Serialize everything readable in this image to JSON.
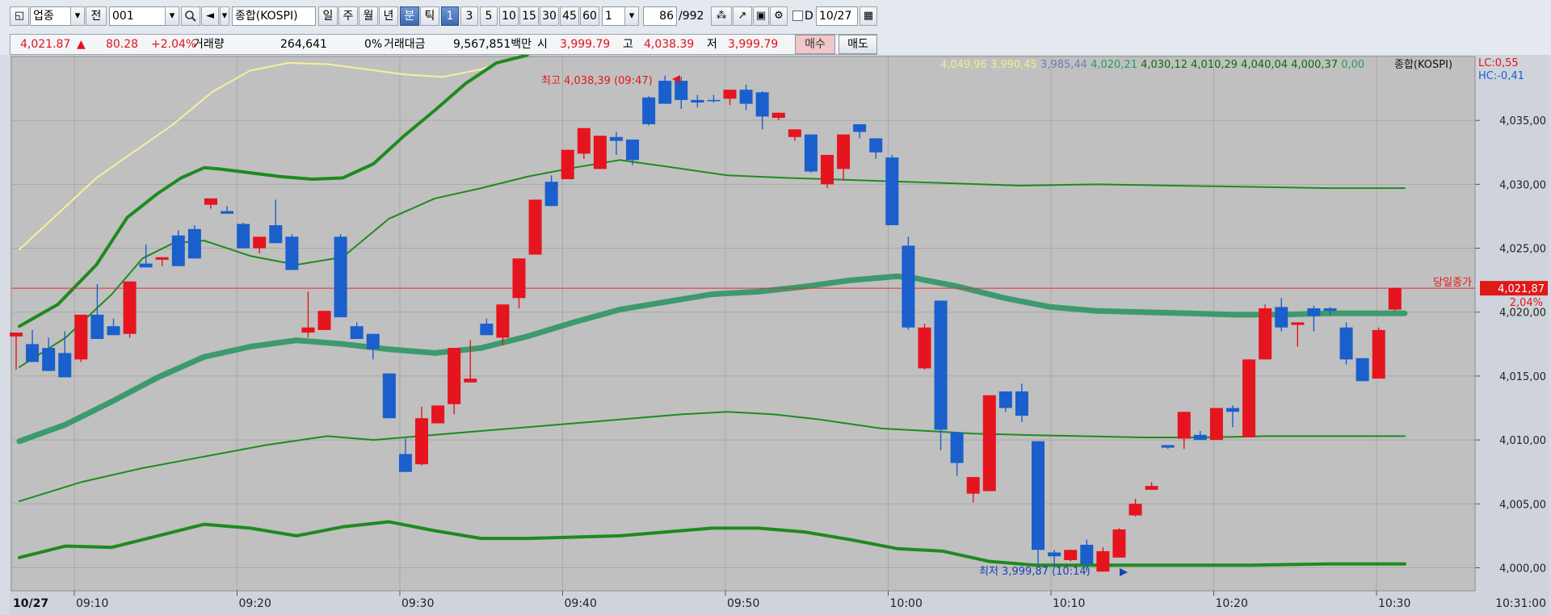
{
  "toolbar": {
    "market_type": "업종",
    "prev_label": "전",
    "code": "001",
    "index_name": "종합(KOSPI)",
    "period_buttons": [
      "일",
      "주",
      "월",
      "년",
      "분",
      "틱"
    ],
    "minute_buttons": [
      "1",
      "3",
      "5",
      "10",
      "15",
      "30",
      "45",
      "60"
    ],
    "interval_value": "1",
    "count_current": "86",
    "count_total": "/992",
    "d_label": "D",
    "date": "10/27"
  },
  "quote": {
    "price": "4,021.87",
    "arrow": "▲",
    "change": "80.28",
    "change_pct": "+2.04%",
    "volume_label": "거래량",
    "volume": "264,641",
    "volume_pct": "0%",
    "amount_label": "거래대금",
    "amount": "9,567,851백만",
    "open_label": "시",
    "open": "3,999.79",
    "high_label": "고",
    "high": "4,038.39",
    "low_label": "저",
    "low": "3,999.79",
    "buy_label": "매수",
    "sell_label": "매도"
  },
  "colors": {
    "up": "#e5141e",
    "down": "#1a5fcc",
    "plot_bg": "#c0c0c0",
    "band_outer": "#1f8a1f",
    "band_mid": "#3c9a6e",
    "band_upper_yellow": "#f5f09a",
    "ref_line": "#e03030"
  },
  "chart_data": {
    "type": "candlestick",
    "x_ticks": [
      "09:10",
      "09:20",
      "09:30",
      "09:40",
      "09:50",
      "10:00",
      "10:10",
      "10:20",
      "10:30"
    ],
    "x_date_label": "10/27",
    "x_end_label": "10:31:00",
    "y_ticks": [
      "4,035,00",
      "4,030,00",
      "4,025,00",
      "4,020,00",
      "4,015,00",
      "4,010,00",
      "4,005,00",
      "4,000,00"
    ],
    "y_range": [
      3998.2,
      4040.0
    ],
    "legend_values": [
      {
        "text": "4,049,96",
        "color": "#f0ec90"
      },
      {
        "text": "3,990,45",
        "color": "#f0ec90"
      },
      {
        "text": "3,985,44",
        "color": "#6a7eb4"
      },
      {
        "text": "4,020,21",
        "color": "#2c9a5a"
      },
      {
        "text": "4,030,12",
        "color": "#0a6e0a"
      },
      {
        "text": "4,010,29",
        "color": "#0a6e0a"
      },
      {
        "text": "4,040,04",
        "color": "#0a6e0a"
      },
      {
        "text": "4,000,37",
        "color": "#0a6e0a"
      },
      {
        "text": "0,00",
        "color": "#2c9a5a"
      }
    ],
    "legend_title": "종합(KOSPI)",
    "lc": "LC:0,55",
    "hc": "HC:-0,41",
    "high_annotation": "최고 4,038,39 (09:47)",
    "low_annotation": "최저 3,999,87 (10:14)",
    "close_label": "당일종가",
    "close_value": "4,021,87",
    "close_pct": "2,04%",
    "ref_value": 4021.87,
    "candles": [
      [
        4018.1,
        4015.7,
        4018.4,
        4015.5
      ],
      [
        4017.5,
        4018.2,
        4016.1,
        4018.6
      ],
      [
        4017.2,
        4018.0,
        4015.4,
        4016.5
      ],
      [
        4016.8,
        4016.3,
        4014.9,
        4018.5
      ],
      [
        4016.3,
        4016.9,
        4019.8,
        4016.1
      ],
      [
        4019.8,
        4020.4,
        4017.9,
        4022.2
      ],
      [
        4018.9,
        4018.4,
        4018.2,
        4019.5
      ],
      [
        4018.3,
        4018.0,
        4022.4,
        4018.0
      ],
      [
        4023.8,
        4024.9,
        4023.5,
        4025.3
      ],
      [
        4024.1,
        4024.3,
        4024.3,
        4023.6
      ],
      [
        4026.0,
        4026.4,
        4023.6,
        4026.2
      ],
      [
        4026.5,
        4026.2,
        4024.2,
        4026.8
      ],
      [
        4028.4,
        4028.8,
        4028.9,
        4028.1
      ],
      [
        4027.9,
        4028.3,
        4027.7,
        4028.0
      ],
      [
        4026.9,
        4027.0,
        4025.0,
        4026.2
      ],
      [
        4025.0,
        4025.4,
        4025.9,
        4024.6
      ],
      [
        4026.8,
        4028.8,
        4025.4,
        4026.0
      ],
      [
        4025.9,
        4026.1,
        4023.3,
        4026.1
      ],
      [
        4018.4,
        4021.6,
        4018.8,
        4018.0
      ],
      [
        4018.6,
        4019.0,
        4020.1,
        4018.7
      ],
      [
        4025.9,
        4026.1,
        4019.6,
        4025.6
      ],
      [
        4018.9,
        4019.2,
        4017.9,
        4018.9
      ],
      [
        4018.3,
        4016.4,
        4017.1,
        4016.3
      ],
      [
        4015.2,
        4014.2,
        4011.7,
        4013.8
      ],
      [
        4008.9,
        4010.1,
        4007.5,
        4009.5
      ],
      [
        4008.1,
        4008.0,
        4011.7,
        4012.6
      ],
      [
        4011.3,
        4011.4,
        4012.7,
        4012.5
      ],
      [
        4012.8,
        4012.9,
        4017.2,
        4012.0
      ],
      [
        4014.5,
        4017.8,
        4014.8,
        4016.8
      ],
      [
        4019.1,
        4019.1,
        4018.2,
        4019.5
      ],
      [
        4018.0,
        4017.4,
        4020.6,
        4018.5
      ],
      [
        4021.1,
        4020.7,
        4024.2,
        4020.3
      ],
      [
        4024.5,
        4024.6,
        4028.8,
        4024.7
      ],
      [
        4030.2,
        4030.7,
        4028.3,
        4029.7
      ],
      [
        4030.4,
        4031.1,
        4032.7,
        4031.4
      ],
      [
        4032.4,
        4032.0,
        4034.4,
        4032.0
      ],
      [
        4031.2,
        4031.5,
        4033.8,
        4032.1
      ],
      [
        4033.7,
        4034.1,
        4033.4,
        4032.3
      ],
      [
        4033.5,
        4033.2,
        4031.9,
        4031.5
      ],
      [
        4036.8,
        4036.9,
        4034.7,
        4034.6
      ],
      [
        4038.1,
        4038.5,
        4036.3,
        4036.5
      ],
      [
        4038.1,
        4038.4,
        4036.6,
        4035.9
      ],
      [
        4036.6,
        4037.0,
        4036.4,
        4036.0
      ],
      [
        4036.6,
        4036.4,
        4036.5,
        4037.0
      ],
      [
        4036.7,
        4036.4,
        4037.4,
        4036.2
      ],
      [
        4037.4,
        4037.8,
        4036.3,
        4035.8
      ],
      [
        4037.2,
        4037.3,
        4035.3,
        4034.3
      ],
      [
        4035.2,
        4035.2,
        4035.6,
        4035.0
      ],
      [
        4033.7,
        4033.6,
        4034.3,
        4033.4
      ],
      [
        4033.9,
        4033.1,
        4031.0,
        4030.9
      ],
      [
        4030.0,
        4029.7,
        4032.3,
        4030.2
      ],
      [
        4031.2,
        4030.3,
        4033.9,
        4032.4
      ],
      [
        4034.7,
        4034.0,
        4034.1,
        4033.6
      ],
      [
        4033.6,
        4033.6,
        4032.5,
        4032.0
      ],
      [
        4032.1,
        4032.3,
        4026.8,
        4027.1
      ],
      [
        4025.2,
        4025.9,
        4018.8,
        4018.6
      ],
      [
        4015.6,
        4015.5,
        4018.8,
        4019.1
      ],
      [
        4020.9,
        4020.8,
        4010.8,
        4009.2
      ],
      [
        4010.6,
        4009.7,
        4008.2,
        4007.2
      ],
      [
        4005.8,
        4005.2,
        4007.1,
        4005.1
      ],
      [
        4006.0,
        4006.6,
        4013.5,
        4012.8
      ],
      [
        4013.8,
        4013.2,
        4012.5,
        4012.2
      ],
      [
        4013.8,
        4014.4,
        4011.9,
        4011.4
      ],
      [
        4009.9,
        4009.7,
        4001.4,
        4000.2
      ],
      [
        4001.2,
        4001.4,
        4000.9,
        4000.1
      ],
      [
        4000.6,
        4000.5,
        4001.4,
        4001.2
      ],
      [
        4001.8,
        4002.2,
        4000.3,
        3999.7
      ],
      [
        3999.7,
        3999.9,
        4001.3,
        4001.6
      ],
      [
        4000.8,
        4000.9,
        4003.0,
        4003.1
      ],
      [
        4004.1,
        4004.0,
        4005.0,
        4005.4
      ],
      [
        4006.1,
        4006.7,
        4006.4,
        4006.3
      ],
      [
        4009.6,
        4009.3,
        4009.4,
        4009.3
      ],
      [
        4010.1,
        4009.3,
        4012.2,
        4011.4
      ],
      [
        4010.4,
        4010.7,
        4010.0,
        4010.2
      ],
      [
        4010.0,
        4010.4,
        4012.5,
        4011.9
      ],
      [
        4012.5,
        4012.7,
        4012.2,
        4011.0
      ],
      [
        4010.2,
        4010.5,
        4016.3,
        4016.3
      ],
      [
        4016.3,
        4016.8,
        4020.3,
        4020.6
      ],
      [
        4020.4,
        4021.1,
        4018.8,
        4018.5
      ],
      [
        4019.0,
        4017.3,
        4019.2,
        4019.1
      ],
      [
        4020.3,
        4020.5,
        4019.7,
        4018.5
      ],
      [
        4020.3,
        4020.4,
        4020.1,
        4019.7
      ],
      [
        4018.8,
        4019.2,
        4016.3,
        4015.9
      ],
      [
        4016.4,
        4016.1,
        4014.6,
        4014.6
      ],
      [
        4014.8,
        4014.9,
        4018.6,
        4018.8
      ],
      [
        4020.2,
        4020.1,
        4021.9,
        4020.4
      ]
    ],
    "candle_fields": [
      "open",
      "high_or_low_a",
      "close",
      "wick_b"
    ],
    "lines": [
      {
        "name": "yellow",
        "color": "#f5f09a",
        "width": 2,
        "points": [
          [
            0,
            4024.9
          ],
          [
            10,
            4030.5
          ],
          [
            20,
            4034.7
          ],
          [
            25,
            4037.2
          ],
          [
            30,
            4038.9
          ],
          [
            35,
            4039.5
          ],
          [
            40,
            4039.4
          ],
          [
            45,
            4039.0
          ],
          [
            50,
            4038.6
          ],
          [
            55,
            4038.4
          ],
          [
            60,
            4039.0
          ],
          [
            62,
            4039.4
          ]
        ]
      },
      {
        "name": "upper_band",
        "color": "#1f8a1f",
        "width": 4,
        "points": [
          [
            0,
            4018.9
          ],
          [
            5,
            4020.6
          ],
          [
            10,
            4023.7
          ],
          [
            14,
            4027.4
          ],
          [
            18,
            4029.3
          ],
          [
            21,
            4030.5
          ],
          [
            24,
            4031.3
          ],
          [
            26,
            4031.2
          ],
          [
            30,
            4030.9
          ],
          [
            34,
            4030.6
          ],
          [
            38,
            4030.4
          ],
          [
            42,
            4030.5
          ],
          [
            46,
            4031.6
          ],
          [
            50,
            4033.8
          ],
          [
            54,
            4035.8
          ],
          [
            58,
            4037.9
          ],
          [
            62,
            4039.5
          ],
          [
            66,
            4040.1
          ]
        ]
      },
      {
        "name": "upper_mid",
        "color": "#1f8a1f",
        "width": 2,
        "points": [
          [
            0,
            4015.7
          ],
          [
            6,
            4018.0
          ],
          [
            12,
            4021.4
          ],
          [
            16,
            4024.2
          ],
          [
            20,
            4025.4
          ],
          [
            24,
            4025.6
          ],
          [
            30,
            4024.4
          ],
          [
            36,
            4023.7
          ],
          [
            42,
            4024.3
          ],
          [
            48,
            4027.3
          ],
          [
            54,
            4028.9
          ],
          [
            60,
            4029.7
          ],
          [
            66,
            4030.6
          ],
          [
            72,
            4031.3
          ],
          [
            78,
            4031.9
          ],
          [
            84,
            4031.4
          ],
          [
            92,
            4030.7
          ],
          [
            100,
            4030.5
          ],
          [
            110,
            4030.3
          ],
          [
            120,
            4030.1
          ],
          [
            130,
            4029.9
          ],
          [
            140,
            4030.0
          ],
          [
            150,
            4029.9
          ],
          [
            160,
            4029.8
          ],
          [
            170,
            4029.7
          ],
          [
            180,
            4029.7
          ]
        ]
      },
      {
        "name": "middle",
        "color": "#3c9a6e",
        "width": 7,
        "points": [
          [
            0,
            4009.9
          ],
          [
            6,
            4011.2
          ],
          [
            12,
            4013.0
          ],
          [
            18,
            4014.9
          ],
          [
            24,
            4016.5
          ],
          [
            30,
            4017.3
          ],
          [
            36,
            4017.8
          ],
          [
            42,
            4017.5
          ],
          [
            48,
            4017.1
          ],
          [
            54,
            4016.8
          ],
          [
            60,
            4017.2
          ],
          [
            66,
            4018.1
          ],
          [
            72,
            4019.2
          ],
          [
            78,
            4020.2
          ],
          [
            84,
            4020.8
          ],
          [
            90,
            4021.4
          ],
          [
            96,
            4021.6
          ],
          [
            102,
            4022.0
          ],
          [
            108,
            4022.5
          ],
          [
            114,
            4022.8
          ],
          [
            116,
            4022.7
          ],
          [
            122,
            4022.0
          ],
          [
            128,
            4021.1
          ],
          [
            134,
            4020.4
          ],
          [
            140,
            4020.1
          ],
          [
            146,
            4020.0
          ],
          [
            152,
            4019.9
          ],
          [
            158,
            4019.8
          ],
          [
            164,
            4019.8
          ],
          [
            170,
            4019.9
          ],
          [
            176,
            4019.9
          ],
          [
            180,
            4019.9
          ]
        ]
      },
      {
        "name": "lower_mid",
        "color": "#1f8a1f",
        "width": 2,
        "points": [
          [
            0,
            4005.2
          ],
          [
            8,
            4006.7
          ],
          [
            16,
            4007.8
          ],
          [
            24,
            4008.7
          ],
          [
            32,
            4009.6
          ],
          [
            40,
            4010.3
          ],
          [
            46,
            4010.0
          ],
          [
            54,
            4010.4
          ],
          [
            62,
            4010.8
          ],
          [
            70,
            4011.2
          ],
          [
            78,
            4011.6
          ],
          [
            86,
            4012.0
          ],
          [
            92,
            4012.2
          ],
          [
            98,
            4012.0
          ],
          [
            104,
            4011.6
          ],
          [
            112,
            4010.9
          ],
          [
            118,
            4010.7
          ],
          [
            124,
            4010.5
          ],
          [
            130,
            4010.4
          ],
          [
            138,
            4010.3
          ],
          [
            146,
            4010.2
          ],
          [
            154,
            4010.2
          ],
          [
            162,
            4010.3
          ],
          [
            170,
            4010.3
          ],
          [
            180,
            4010.3
          ]
        ]
      },
      {
        "name": "lower_band",
        "color": "#1f8a1f",
        "width": 4,
        "points": [
          [
            0,
            4000.8
          ],
          [
            6,
            4001.7
          ],
          [
            12,
            4001.6
          ],
          [
            18,
            4002.5
          ],
          [
            24,
            4003.4
          ],
          [
            30,
            4003.1
          ],
          [
            36,
            4002.5
          ],
          [
            42,
            4003.2
          ],
          [
            48,
            4003.6
          ],
          [
            54,
            4002.9
          ],
          [
            60,
            4002.3
          ],
          [
            66,
            4002.3
          ],
          [
            72,
            4002.4
          ],
          [
            78,
            4002.5
          ],
          [
            84,
            4002.8
          ],
          [
            90,
            4003.1
          ],
          [
            96,
            4003.1
          ],
          [
            102,
            4002.8
          ],
          [
            108,
            4002.2
          ],
          [
            114,
            4001.5
          ],
          [
            120,
            4001.3
          ],
          [
            126,
            4000.5
          ],
          [
            132,
            4000.2
          ],
          [
            140,
            4000.2
          ],
          [
            150,
            4000.2
          ],
          [
            160,
            4000.2
          ],
          [
            170,
            4000.3
          ],
          [
            180,
            4000.3
          ]
        ]
      }
    ]
  }
}
